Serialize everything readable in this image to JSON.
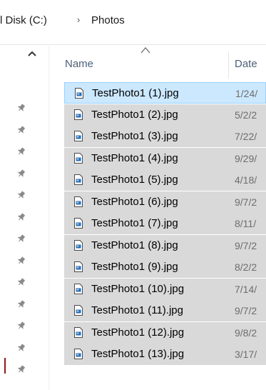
{
  "address_bar": {
    "parent": "l Disk (C:)",
    "separator": "›",
    "current": "Photos"
  },
  "columns": {
    "name": "Name",
    "date": "Date"
  },
  "icons": {
    "scroll_up": "chevron-up-icon",
    "pin": "pin-icon",
    "sort": "sort-ascending-icon",
    "file": "jpg-file-icon"
  },
  "colors": {
    "selected_row": "#cce8ff",
    "selected_border": "#99d1ff",
    "row_highlight": "#d9d9d9",
    "header_text": "#4c607a"
  },
  "files": [
    {
      "name": "TestPhoto1 (1).jpg",
      "date": "1/24/"
    },
    {
      "name": "TestPhoto1 (2).jpg",
      "date": "5/2/2"
    },
    {
      "name": "TestPhoto1 (3).jpg",
      "date": "7/22/"
    },
    {
      "name": "TestPhoto1 (4).jpg",
      "date": "9/29/"
    },
    {
      "name": "TestPhoto1 (5).jpg",
      "date": "4/18/"
    },
    {
      "name": "TestPhoto1 (6).jpg",
      "date": "9/7/2"
    },
    {
      "name": "TestPhoto1 (7).jpg",
      "date": "8/11/"
    },
    {
      "name": "TestPhoto1 (8).jpg",
      "date": "9/7/2"
    },
    {
      "name": "TestPhoto1 (9).jpg",
      "date": "8/2/2"
    },
    {
      "name": "TestPhoto1 (10).jpg",
      "date": "7/14/"
    },
    {
      "name": "TestPhoto1 (11).jpg",
      "date": "9/7/2"
    },
    {
      "name": "TestPhoto1 (12).jpg",
      "date": "9/8/2"
    },
    {
      "name": "TestPhoto1 (13).jpg",
      "date": "3/17/"
    }
  ]
}
